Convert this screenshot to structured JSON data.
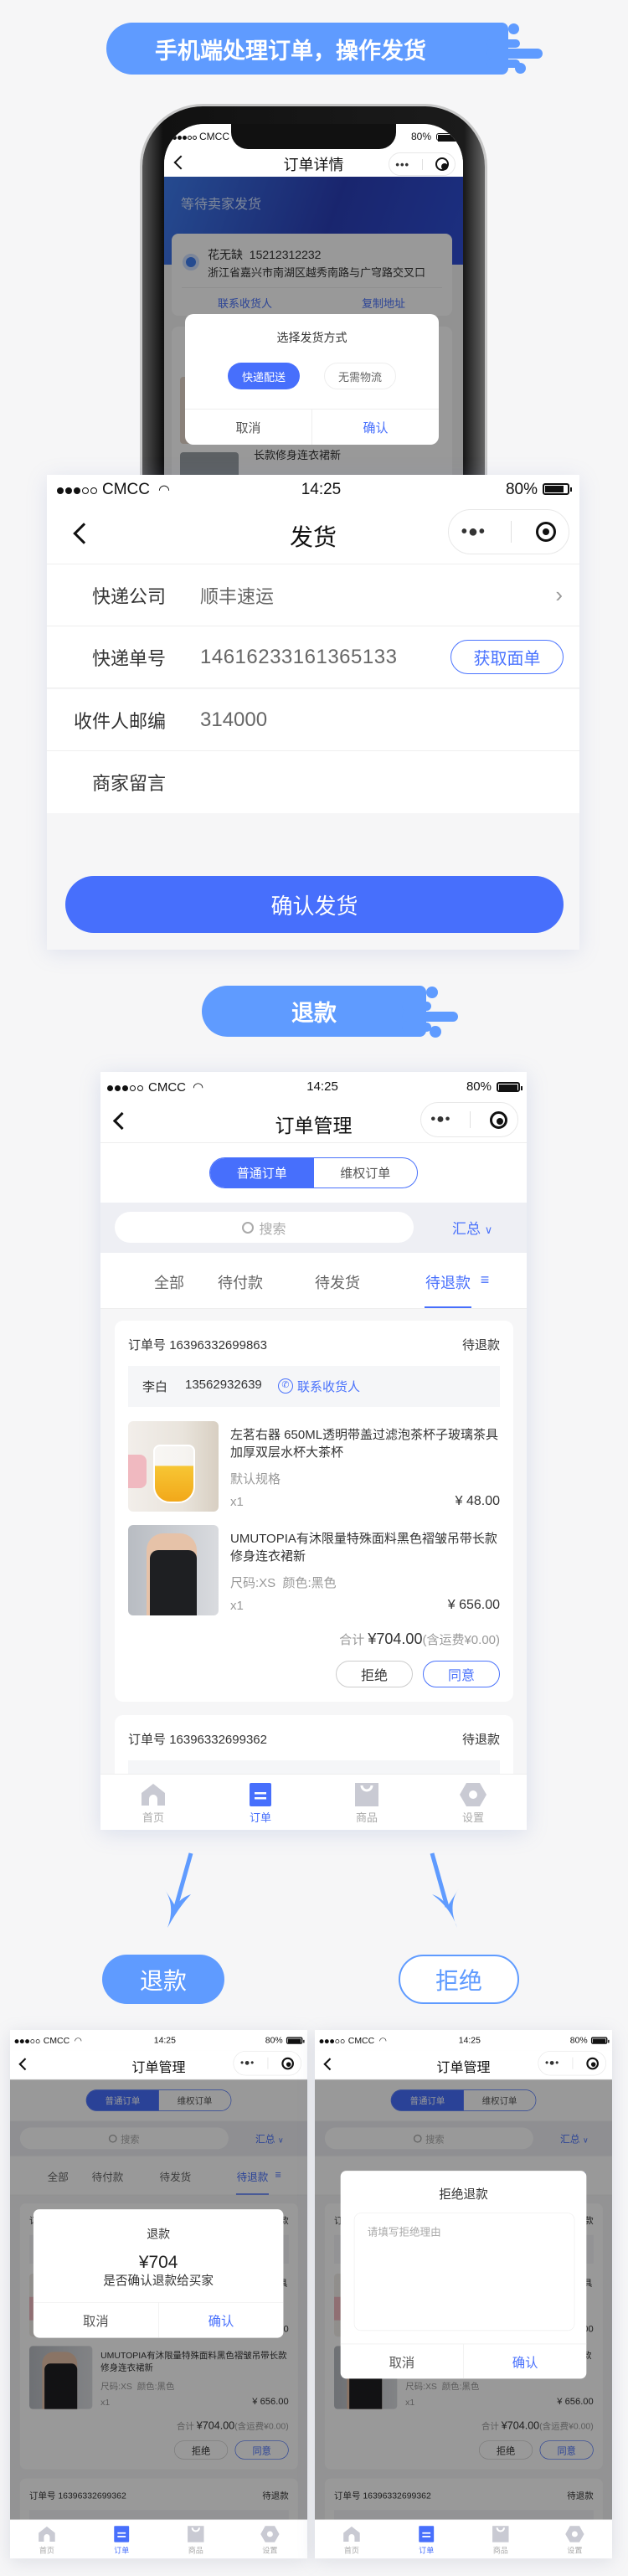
{
  "colors": {
    "accent": "#476ffc",
    "banner": "#5f9bff",
    "page_bg": "#f6f6f7",
    "link": "#4a72fb"
  },
  "banner_ship": {
    "text": "手机端处理订单，操作发货"
  },
  "status_bar": {
    "carrier": "CMCC",
    "time": "14:25",
    "battery": "80%"
  },
  "phone_mock": {
    "title": "订单详情",
    "status_text": "等待卖家发货",
    "address": {
      "name": "花无缺",
      "phone": "15212312232",
      "address": "浙江省嘉兴市南湖区越秀南路与广穹路交叉口",
      "contact": "联系收货人",
      "copy": "复制地址"
    },
    "behind_text": "长款修身连衣裙新",
    "dialog": {
      "title": "选择发货方式",
      "options": [
        "快递配送",
        "无需物流"
      ],
      "cancel": "取消",
      "confirm": "确认"
    }
  },
  "ship": {
    "title": "发货",
    "rows": [
      {
        "label": "快递公司",
        "value": "顺丰速运"
      },
      {
        "label": "快递单号",
        "value": "14616233161365133"
      },
      {
        "label": "收件人邮编",
        "value": "314000"
      },
      {
        "label": "商家留言",
        "value": ""
      }
    ],
    "get_waybill": "获取面单",
    "confirm": "确认发货"
  },
  "banner_refund": {
    "text": "退款"
  },
  "orders_screen": {
    "title": "订单管理",
    "segments": [
      "普通订单",
      "维权订单"
    ],
    "search_placeholder": "搜索",
    "summary": "汇总",
    "tabs": [
      "全部",
      "待付款",
      "待发货",
      "待退款"
    ],
    "orders": [
      {
        "order_label": "订单号",
        "order_no": "16396332699863",
        "status": "待退款",
        "contact": {
          "name": "李白",
          "phone": "13562932639",
          "link": "联系收货人"
        },
        "items": [
          {
            "title": "左茗右器 650ML透明带盖过滤泡茶杯子玻璃茶具加厚双层水杯大茶杯",
            "spec": "默认规格",
            "qty": "x1",
            "price": "¥ 48.00"
          },
          {
            "title": "UMUTOPIA有沐限量特殊面料黑色褶皱吊带长款修身连衣裙新",
            "spec": "尺码:XS  颜色:黑色",
            "qty": "x1",
            "price": "¥ 656.00"
          }
        ],
        "total_label": "合计",
        "total": "¥704.00",
        "shipping_note": "(含运费¥0.00)",
        "reject": "拒绝",
        "agree": "同意"
      },
      {
        "order_label": "订单号",
        "order_no": "16396332699362",
        "status": "待退款"
      }
    ],
    "tabbar": [
      {
        "label": "首页",
        "icon": "home-icon"
      },
      {
        "label": "订单",
        "icon": "order-icon",
        "active": true
      },
      {
        "label": "商品",
        "icon": "shopping-bag-icon"
      },
      {
        "label": "设置",
        "icon": "settings-icon"
      }
    ]
  },
  "flow": {
    "refund": "退款",
    "reject": "拒绝"
  },
  "refund_dialog": {
    "title": "退款",
    "amount": "¥704",
    "message": "是否确认退款给买家",
    "cancel": "取消",
    "confirm": "确认"
  },
  "reject_dialog": {
    "title": "拒绝退款",
    "placeholder": "请填写拒绝理由",
    "cancel": "取消",
    "confirm": "确认"
  }
}
